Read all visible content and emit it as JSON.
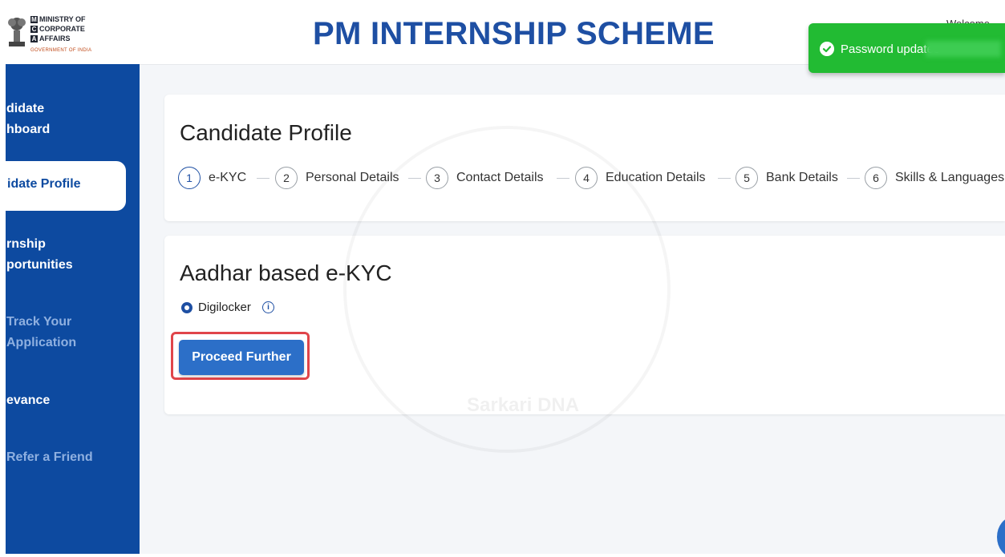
{
  "header": {
    "ministry_lines": [
      "MINISTRY OF",
      "CORPORATE",
      "AFFAIRS"
    ],
    "ministry_initials": [
      "M",
      "C",
      "A"
    ],
    "gov_label": "GOVERNMENT OF INDIA",
    "title": "PM INTERNSHIP SCHEME",
    "welcome": "Welcome"
  },
  "toast": {
    "message": "Password updatec",
    "color": "#22bb33"
  },
  "sidebar": {
    "items": [
      {
        "line1": "didate",
        "line2": "hboard"
      },
      {
        "label": "idate Profile"
      },
      {
        "line1": "rnship",
        "line2": "portunities"
      },
      {
        "line1": "Track Your",
        "line2": "Application"
      },
      {
        "label": "evance"
      },
      {
        "label": "Refer a Friend"
      }
    ],
    "color": "#0d4aa0"
  },
  "profile": {
    "heading": "Candidate Profile",
    "steps": [
      {
        "num": "1",
        "label": "e-KYC"
      },
      {
        "num": "2",
        "label": "Personal Details"
      },
      {
        "num": "3",
        "label": "Contact Details"
      },
      {
        "num": "4",
        "label": "Education Details"
      },
      {
        "num": "5",
        "label": "Bank Details"
      },
      {
        "num": "6",
        "label": "Skills & Languages"
      }
    ]
  },
  "kyc": {
    "heading": "Aadhar based e-KYC",
    "option": "Digilocker",
    "info_icon": "i",
    "button": "Proceed Further"
  },
  "watermark": {
    "text": "Sarkari DNA"
  }
}
